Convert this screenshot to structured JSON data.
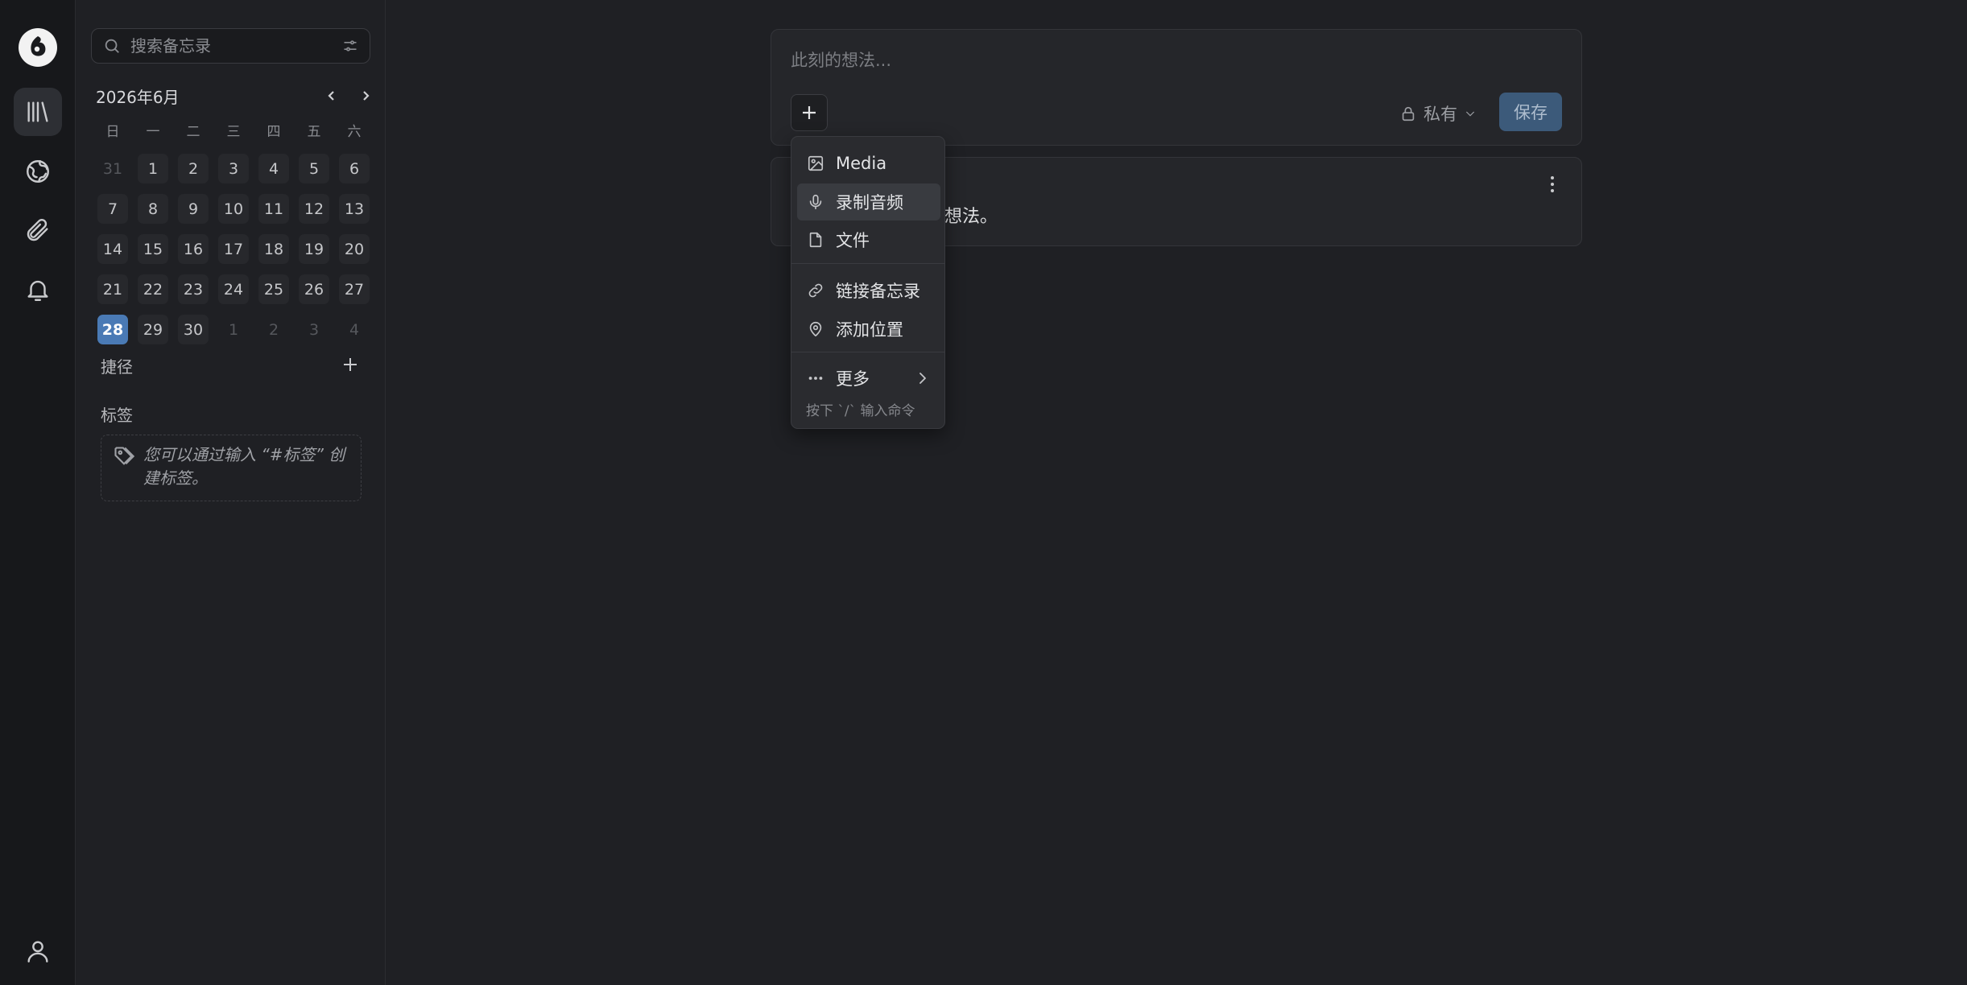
{
  "search": {
    "placeholder": "搜索备忘录"
  },
  "calendar": {
    "title": "2026年6月",
    "weekdays": [
      "日",
      "一",
      "二",
      "三",
      "四",
      "五",
      "六"
    ],
    "days": [
      {
        "d": "31",
        "muted": true
      },
      {
        "d": "1"
      },
      {
        "d": "2"
      },
      {
        "d": "3"
      },
      {
        "d": "4"
      },
      {
        "d": "5"
      },
      {
        "d": "6"
      },
      {
        "d": "7"
      },
      {
        "d": "8"
      },
      {
        "d": "9"
      },
      {
        "d": "10"
      },
      {
        "d": "11"
      },
      {
        "d": "12"
      },
      {
        "d": "13"
      },
      {
        "d": "14"
      },
      {
        "d": "15"
      },
      {
        "d": "16"
      },
      {
        "d": "17"
      },
      {
        "d": "18"
      },
      {
        "d": "19"
      },
      {
        "d": "20"
      },
      {
        "d": "21"
      },
      {
        "d": "22"
      },
      {
        "d": "23"
      },
      {
        "d": "24"
      },
      {
        "d": "25"
      },
      {
        "d": "26"
      },
      {
        "d": "27"
      },
      {
        "d": "28",
        "today": true
      },
      {
        "d": "29"
      },
      {
        "d": "30"
      },
      {
        "d": "1",
        "muted": true
      },
      {
        "d": "2",
        "muted": true
      },
      {
        "d": "3",
        "muted": true
      },
      {
        "d": "4",
        "muted": true
      }
    ]
  },
  "sidebar": {
    "shortcuts_label": "捷径",
    "tags_label": "标签",
    "tags_hint": "您可以通过输入 “#标签” 创建标签。"
  },
  "composer": {
    "placeholder": "此刻的想法...",
    "visibility": "私有",
    "save_label": "保存"
  },
  "memo": {
    "visible_text": "想法。"
  },
  "menu": {
    "items": [
      {
        "label": "Media",
        "icon": "image-icon"
      },
      {
        "label": "录制音频",
        "icon": "microphone-icon"
      },
      {
        "label": "文件",
        "icon": "file-icon"
      },
      {
        "label": "链接备忘录",
        "icon": "link-icon"
      },
      {
        "label": "添加位置",
        "icon": "map-pin-icon"
      },
      {
        "label": "更多",
        "icon": "more-dots-icon"
      }
    ],
    "hint": "按下 `/` 输入命令"
  },
  "colors": {
    "accent": "#4a7ab5",
    "save_button": "#3c5a7a",
    "background": "#1f2024"
  }
}
